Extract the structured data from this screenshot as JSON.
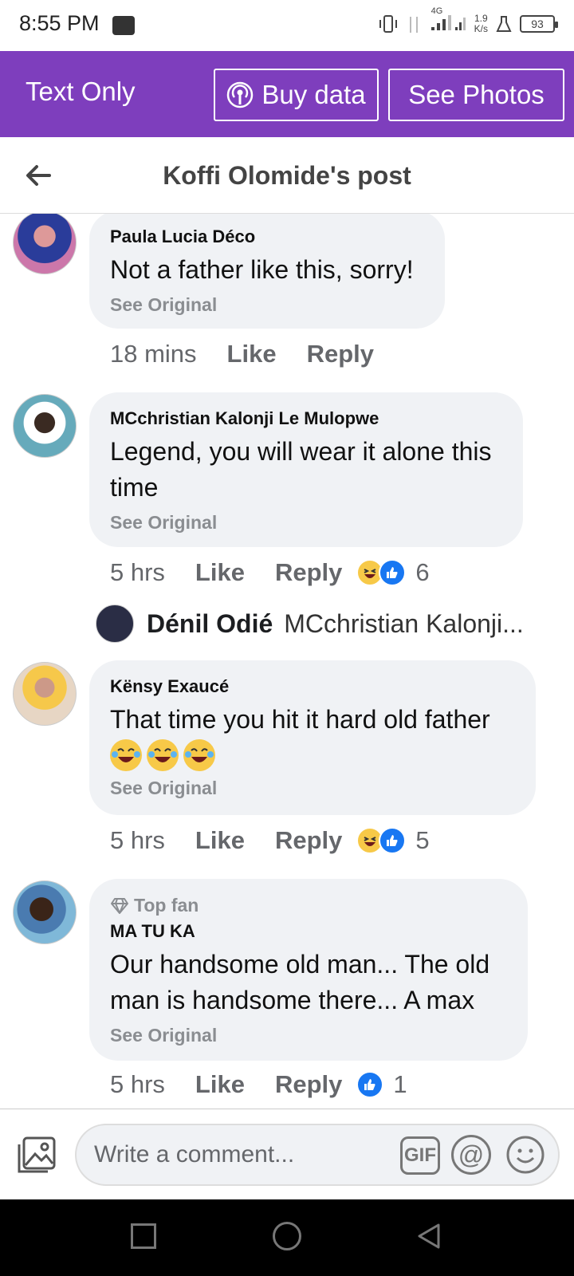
{
  "status": {
    "time": "8:55 PM",
    "network": "4G",
    "speed_value": "1.9",
    "speed_unit": "K/s",
    "battery": "93"
  },
  "topbar": {
    "mode_label": "Text Only",
    "buy_data_label": "Buy data",
    "see_photos_label": "See Photos"
  },
  "header": {
    "title": "Koffi Olomide's post"
  },
  "comments": [
    {
      "author": "Paula Lucia Déco",
      "text": "Not a father like this, sorry!",
      "see_original": "See Original",
      "time": "18 mins",
      "like": "Like",
      "reply": "Reply"
    },
    {
      "author": "MCchristian Kalonji Le Mulopwe",
      "text": "Legend, you will wear it alone this time",
      "see_original": "See Original",
      "time": "5 hrs",
      "like": "Like",
      "reply": "Reply",
      "reaction_count": "6"
    },
    {
      "author": "Kënsy Exaucé",
      "text": "That time you hit it hard old father",
      "see_original": "See Original",
      "time": "5 hrs",
      "like": "Like",
      "reply": "Reply",
      "reaction_count": "5"
    },
    {
      "badge": "Top fan",
      "author": "MA TU KA",
      "text": "Our handsome old man... The old man is handsome there... A max",
      "see_original": "See Original",
      "time": "5 hrs",
      "like": "Like",
      "reply": "Reply",
      "reaction_count": "1"
    }
  ],
  "reply_preview": {
    "author": "Dénil Odié",
    "text": "MCchristian Kalonji..."
  },
  "composer": {
    "placeholder": "Write a comment...",
    "gif_label": "GIF",
    "at_label": "@"
  },
  "colors": {
    "brand_purple": "#7e3ebd",
    "bubble_bg": "#f0f2f5",
    "like_blue": "#1877f2"
  }
}
